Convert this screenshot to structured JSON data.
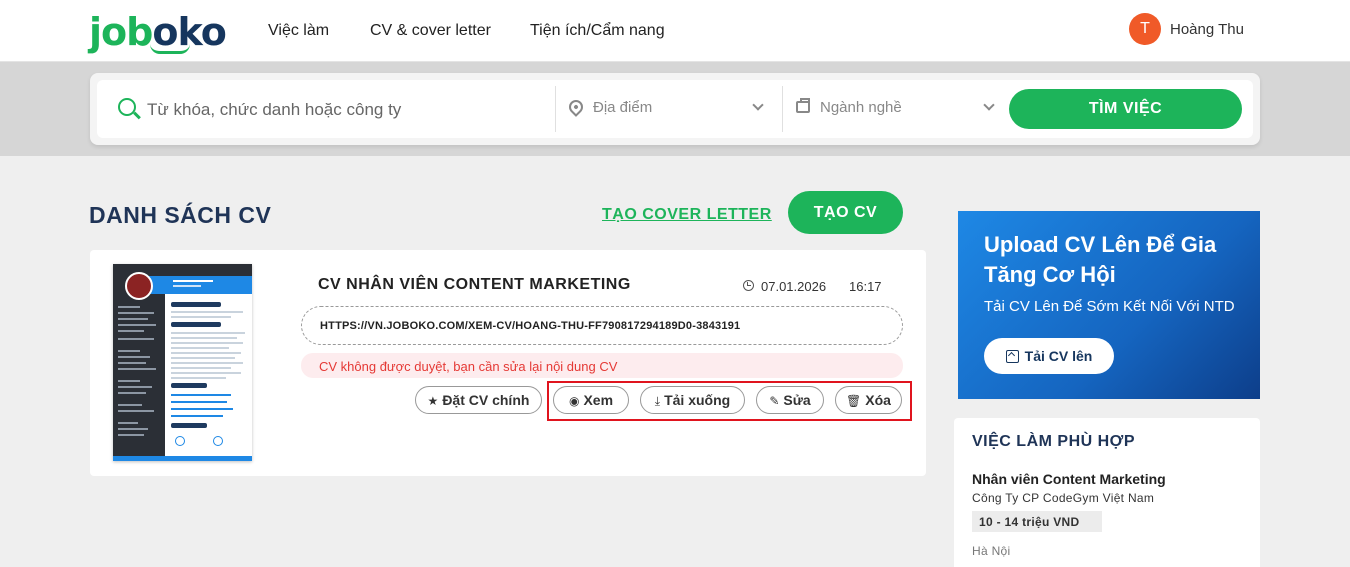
{
  "header": {
    "logo": {
      "part1": "job",
      "part2": "oko"
    },
    "nav": [
      "Việc làm",
      "CV & cover letter",
      "Tiện ích/Cẩm nang"
    ],
    "user": {
      "initial": "T",
      "name": "Hoàng Thu"
    }
  },
  "search": {
    "keyword_placeholder": "Từ khóa, chức danh hoặc công ty",
    "location_placeholder": "Địa điểm",
    "industry_placeholder": "Ngành nghề",
    "button": "TÌM VIỆC"
  },
  "page": {
    "title": "DANH SÁCH CV",
    "cover_letter_link": "TẠO COVER LETTER",
    "create_cv_button": "TẠO CV"
  },
  "cv": {
    "title": "CV NHÂN VIÊN CONTENT MARKETING",
    "date": "07.01.2026",
    "time": "16:17",
    "url": "HTTPS://VN.JOBOKO.COM/XEM-CV/HOANG-THU-FF790817294189D0-3843191",
    "warning": "CV không được duyệt, bạn cần sửa lại nội dung CV",
    "actions": {
      "set_main": "Đặt CV chính",
      "view": "Xem",
      "download": "Tải xuống",
      "edit": "Sửa",
      "delete": "Xóa"
    }
  },
  "banner": {
    "title": "Upload CV Lên Để Gia Tăng Cơ Hội",
    "subtitle": "Tải CV Lên Để Sớm Kết Nối Với NTD",
    "button": "Tải CV lên"
  },
  "jobs": {
    "title": "VIỆC LÀM PHÙ HỢP",
    "items": [
      {
        "name": "Nhân viên Content Marketing",
        "company": "Công Ty CP CodeGym Việt Nam",
        "salary": "10 - 14 triệu VND",
        "location": "Hà Nội"
      }
    ]
  }
}
